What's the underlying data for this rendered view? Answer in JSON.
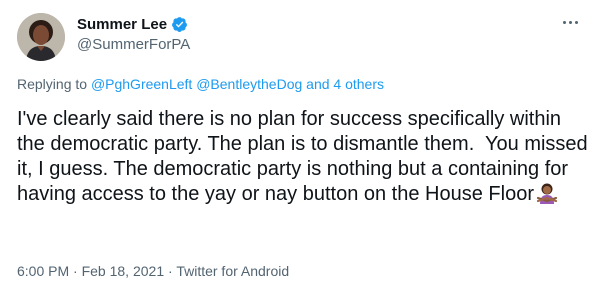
{
  "author": {
    "display_name": "Summer Lee",
    "handle": "@SummerForPA",
    "verified": true
  },
  "menu": {
    "icon": "more-horizontal-icon"
  },
  "reply_context": {
    "prefix": "Replying to",
    "mention_1": "@PghGreenLeft",
    "mention_2": "@BentleytheDog",
    "connector": "and",
    "others": "4 others"
  },
  "tweet": {
    "text": "I've clearly said there is no plan for success specifically within the democratic party. The plan is to dismantle them.  You missed it, I guess. The democratic party is nothing but a containing for having access to the yay or nay button on the House Floor",
    "emoji": "person-gesturing-no-emoji"
  },
  "meta": {
    "time": "6:00 PM",
    "separator": "·",
    "date": "Feb 18, 2021",
    "source": "Twitter for Android"
  },
  "colors": {
    "accent": "#1d9bf0",
    "secondary_text": "#536471",
    "primary_text": "#0f1419"
  }
}
